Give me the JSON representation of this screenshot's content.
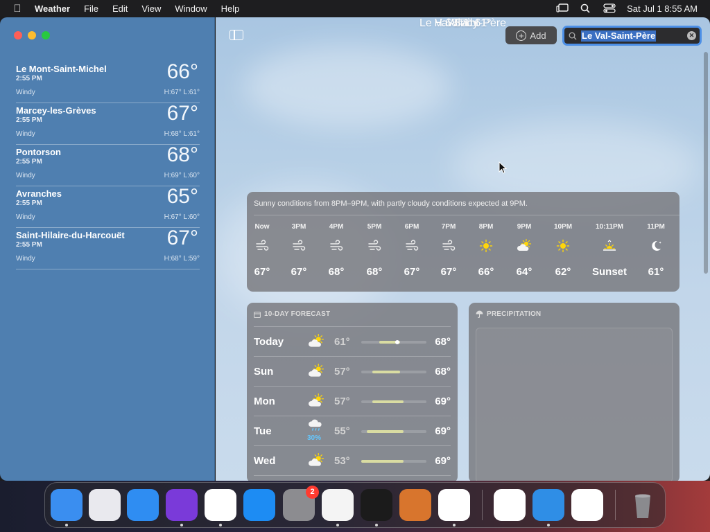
{
  "menubar": {
    "app_name": "Weather",
    "items": [
      "File",
      "Edit",
      "View",
      "Window",
      "Help"
    ],
    "datetime": "Sat Jul 1  8:55 AM"
  },
  "sidebar": {
    "locations": [
      {
        "name": "Le Mont-Saint-Michel",
        "time": "2:55 PM",
        "condition": "Windy",
        "temp": "66°",
        "hl": "H:67°  L:61°"
      },
      {
        "name": "Marcey-les-Grèves",
        "time": "2:55 PM",
        "condition": "Windy",
        "temp": "67°",
        "hl": "H:68°  L:61°"
      },
      {
        "name": "Pontorson",
        "time": "2:55 PM",
        "condition": "Windy",
        "temp": "68°",
        "hl": "H:69°  L:60°"
      },
      {
        "name": "Avranches",
        "time": "2:55 PM",
        "condition": "Windy",
        "temp": "65°",
        "hl": "H:67°  L:60°"
      },
      {
        "name": "Saint-Hilaire-du-Harcouët",
        "time": "2:55 PM",
        "condition": "Windy",
        "temp": "67°",
        "hl": "H:68°  L:59°"
      }
    ]
  },
  "toolbar": {
    "add_label": "Add",
    "search_value": "Le Val-Saint-Père"
  },
  "current": {
    "city": "Le Val-Saint-Père",
    "temp": "67°",
    "condition": "Windy",
    "hl": "H:68°  L:61°"
  },
  "hourly": {
    "summary": "Sunny conditions from 8PM–9PM, with partly cloudy conditions expected at 9PM.",
    "hours": [
      {
        "label": "Now",
        "icon": "wind-icon",
        "temp": "67°"
      },
      {
        "label": "3PM",
        "icon": "wind-icon",
        "temp": "67°"
      },
      {
        "label": "4PM",
        "icon": "wind-icon",
        "temp": "68°"
      },
      {
        "label": "5PM",
        "icon": "wind-icon",
        "temp": "68°"
      },
      {
        "label": "6PM",
        "icon": "wind-icon",
        "temp": "67°"
      },
      {
        "label": "7PM",
        "icon": "wind-icon",
        "temp": "67°"
      },
      {
        "label": "8PM",
        "icon": "sun-icon",
        "temp": "66°"
      },
      {
        "label": "9PM",
        "icon": "partly-cloudy-icon",
        "temp": "64°"
      },
      {
        "label": "10PM",
        "icon": "sun-icon",
        "temp": "62°"
      },
      {
        "label": "10:11PM",
        "icon": "sunset-icon",
        "temp": "Sunset"
      },
      {
        "label": "11PM",
        "icon": "moon-icon",
        "temp": "61°"
      }
    ]
  },
  "tenday": {
    "title": "10-DAY FORECAST",
    "days": [
      {
        "day": "Today",
        "icon": "partly-cloudy-icon",
        "precip": "",
        "low": "61°",
        "high": "68°",
        "range_start": 0.28,
        "range_end": 0.6,
        "current": 0.55
      },
      {
        "day": "Sun",
        "icon": "partly-cloudy-icon",
        "precip": "",
        "low": "57°",
        "high": "68°",
        "range_start": 0.17,
        "range_end": 0.6,
        "current": null
      },
      {
        "day": "Mon",
        "icon": "partly-cloudy-icon",
        "precip": "",
        "low": "57°",
        "high": "69°",
        "range_start": 0.17,
        "range_end": 0.65,
        "current": null
      },
      {
        "day": "Tue",
        "icon": "rain-icon",
        "precip": "30%",
        "low": "55°",
        "high": "69°",
        "range_start": 0.09,
        "range_end": 0.65,
        "current": null
      },
      {
        "day": "Wed",
        "icon": "partly-cloudy-icon",
        "precip": "",
        "low": "53°",
        "high": "69°",
        "range_start": 0.0,
        "range_end": 0.65,
        "current": null
      }
    ]
  },
  "precipitation": {
    "title": "PRECIPITATION"
  },
  "dock": {
    "apps": [
      {
        "name": "finder",
        "color": "#3a8ef0"
      },
      {
        "name": "launchpad",
        "color": "#e9e9ee"
      },
      {
        "name": "safari",
        "color": "#2f8df2"
      },
      {
        "name": "firefox",
        "color": "#7a3ad9"
      },
      {
        "name": "chrome",
        "color": "#ffffff"
      },
      {
        "name": "app-store",
        "color": "#1d8cf3"
      },
      {
        "name": "system-settings",
        "color": "#8c8c90",
        "badge": "2"
      },
      {
        "name": "textedit",
        "color": "#f4f4f4"
      },
      {
        "name": "terminal",
        "color": "#1b1b1b"
      },
      {
        "name": "garageband",
        "color": "#d8752d"
      },
      {
        "name": "vscode",
        "color": "#ffffff"
      },
      {
        "name": "visual-studio",
        "color": "#ffffff"
      },
      {
        "name": "weather",
        "color": "#2f8ee6"
      },
      {
        "name": "news",
        "color": "#ffffff"
      },
      {
        "name": "trash",
        "color": "#8a8a8e"
      }
    ]
  }
}
